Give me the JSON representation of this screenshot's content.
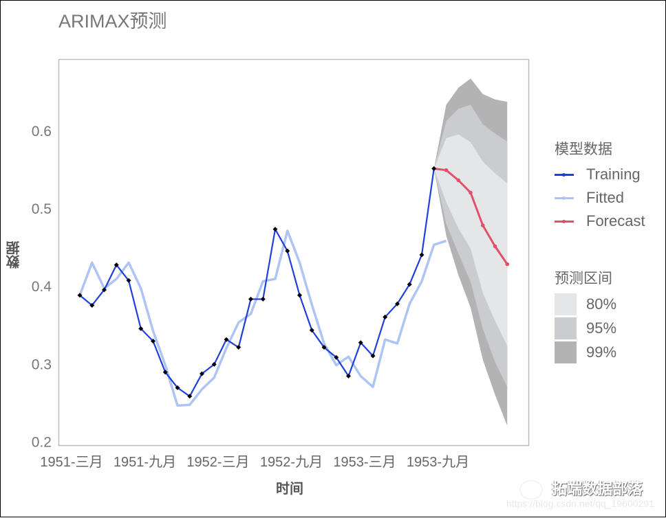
{
  "chart_data": {
    "type": "line",
    "title": "ARIMAX预测",
    "xlabel": "时间",
    "ylabel": "数据",
    "ylim": [
      0.2,
      0.69
    ],
    "yticks": [
      "0.2",
      "0.3",
      "0.4",
      "0.5",
      "0.6"
    ],
    "ytick_values": [
      0.2,
      0.3,
      0.4,
      0.5,
      0.6
    ],
    "xtick_labels": [
      "1951-三月",
      "1951-九月",
      "1952-三月",
      "1952-九月",
      "1953-三月",
      "1953-九月"
    ],
    "xtick_index": [
      0,
      6,
      12,
      18,
      24,
      30
    ],
    "grid": false,
    "legend_position": "right",
    "series": [
      {
        "name": "Training",
        "color": "#1f3fdc",
        "start_index": 0,
        "values": [
          0.388,
          0.375,
          0.395,
          0.427,
          0.407,
          0.345,
          0.329,
          0.289,
          0.269,
          0.258,
          0.287,
          0.299,
          0.331,
          0.321,
          0.383,
          0.383,
          0.473,
          0.445,
          0.388,
          0.343,
          0.321,
          0.308,
          0.284,
          0.327,
          0.31,
          0.36,
          0.377,
          0.402,
          0.44,
          0.551
        ]
      },
      {
        "name": "Fitted",
        "color": "#aec4f5",
        "start_index": 0,
        "values": [
          0.388,
          0.43,
          0.397,
          0.409,
          0.43,
          0.397,
          0.342,
          0.298,
          0.246,
          0.247,
          0.267,
          0.282,
          0.32,
          0.353,
          0.364,
          0.406,
          0.409,
          0.471,
          0.43,
          0.376,
          0.326,
          0.298,
          0.309,
          0.284,
          0.27,
          0.331,
          0.326,
          0.377,
          0.406,
          0.453,
          0.458
        ]
      },
      {
        "name": "Forecast",
        "color": "#e0506a",
        "start_index": 29,
        "values": [
          0.551,
          0.549,
          0.536,
          0.52,
          0.478,
          0.451,
          0.428
        ]
      }
    ],
    "intervals": [
      {
        "name": "99%",
        "color": "#b3b3b3",
        "upper": [
          0.551,
          0.633,
          0.655,
          0.667,
          0.647,
          0.64,
          0.637
        ],
        "lower": [
          0.551,
          0.465,
          0.414,
          0.372,
          0.305,
          0.26,
          0.22
        ]
      },
      {
        "name": "95%",
        "color": "#caccd0",
        "upper": [
          0.551,
          0.612,
          0.628,
          0.633,
          0.608,
          0.596,
          0.586
        ],
        "lower": [
          0.551,
          0.48,
          0.442,
          0.405,
          0.345,
          0.302,
          0.27
        ]
      },
      {
        "name": "80%",
        "color": "#e5e6e8",
        "upper": [
          0.551,
          0.59,
          0.595,
          0.585,
          0.56,
          0.545,
          0.532
        ],
        "lower": [
          0.551,
          0.508,
          0.474,
          0.448,
          0.391,
          0.355,
          0.323
        ]
      }
    ]
  },
  "legend": {
    "model_title": "模型数据",
    "model_items": [
      {
        "label": "Training",
        "color": "#1f3fdc"
      },
      {
        "label": "Fitted",
        "color": "#aec4f5"
      },
      {
        "label": "Forecast",
        "color": "#e0506a"
      }
    ],
    "interval_title": "预测区间",
    "interval_items": [
      {
        "label": "80%",
        "color": "#e5e6e8"
      },
      {
        "label": "95%",
        "color": "#caccd0"
      },
      {
        "label": "99%",
        "color": "#b3b3b3"
      }
    ]
  },
  "watermark": {
    "text": "拓端数据部落",
    "url": "https://blog.csdn.net/qq_19600291"
  }
}
